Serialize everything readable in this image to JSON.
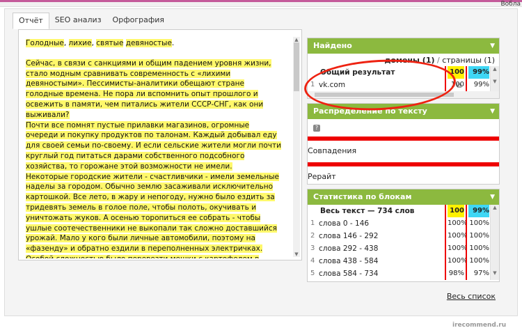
{
  "header": {
    "top_right": "Вобла"
  },
  "tabs": [
    "Отчёт",
    "SEO анализ",
    "Орфография"
  ],
  "text_paragraphs": [
    [
      "Голодные",
      ", ",
      "лихие",
      ", ",
      "святые",
      " ",
      "девяностые",
      "."
    ],
    [
      "Сейчас, в связи с санкциями и общим падением уровня жизни, стало модным сравнивать современность с «лихими девяностыми». Пессимисты-аналитики обещают стране голодные времена. Не пора ли вспомнить опыт прошлого и освежить в памяти, чем питались жители СССР-СНГ, как они выживали?"
    ],
    [
      "Почти все помнят пустые прилавки магазинов, огромные очереди и покупку продуктов по талонам. Каждый добывал еду для своей семьи по-своему. И если сельские жители могли почти круглый год питаться дарами собственного подсобного хозяйства, то горожане этой возможности не имели."
    ],
    [
      "Некоторые городские жители - счастливчики - имели земельные наделы за городом. Обычно землю засаживали исключительно картошкой. Все лето, в жару и непогоду, нужно было ездить за тридевять земель в голое поле, чтобы полоть, окучивать и уничтожать жуков. А осенью торопиться ее собрать - чтобы ушлые соотечественники не выкопали так сложно доставшийся урожай. Мало у кого были личные автомобили, поэтому на «фазенду» и обратно ездили в переполненных электричках. Особой сложностью было перевезти мешки с картофелем в город. Зато вкус у собственноручно выращенного овоща был незабываем!"
    ]
  ],
  "found": {
    "title": "Найдено",
    "domains_label": "домены (1)",
    "sep": "/",
    "pages_label": "страницы (1)",
    "header_row": {
      "label": "Общий результат",
      "c1": "100",
      "c2": "99%"
    },
    "rows": [
      {
        "num": "1",
        "label": "vk.com",
        "c1": "100",
        "c2": "99%"
      }
    ]
  },
  "distribution": {
    "title": "Распределение по тексту",
    "help": "?",
    "label1": "Совпадения",
    "label2": "Рерайт"
  },
  "blocks": {
    "title": "Статистика по блокам",
    "header_row": {
      "label": "Весь текст — 734 слов",
      "c1": "100",
      "c2": "99%"
    },
    "rows": [
      {
        "num": "1",
        "label": "слова 0 - 146",
        "c1": "100%",
        "c2": "100%"
      },
      {
        "num": "2",
        "label": "слова 146 - 292",
        "c1": "100%",
        "c2": "100%"
      },
      {
        "num": "3",
        "label": "слова 292 - 438",
        "c1": "100%",
        "c2": "100%"
      },
      {
        "num": "4",
        "label": "слова 438 - 584",
        "c1": "100%",
        "c2": "100%"
      },
      {
        "num": "5",
        "label": "слова 584 - 734",
        "c1": "98%",
        "c2": "97%"
      }
    ],
    "all_list": "Весь список"
  },
  "watermark": "irecommend.ru",
  "colors": {
    "accent_green": "#8cb93f",
    "highlight_yellow": "#fff86b",
    "match_red": "#e00000",
    "cyan": "#3fd7f5"
  }
}
